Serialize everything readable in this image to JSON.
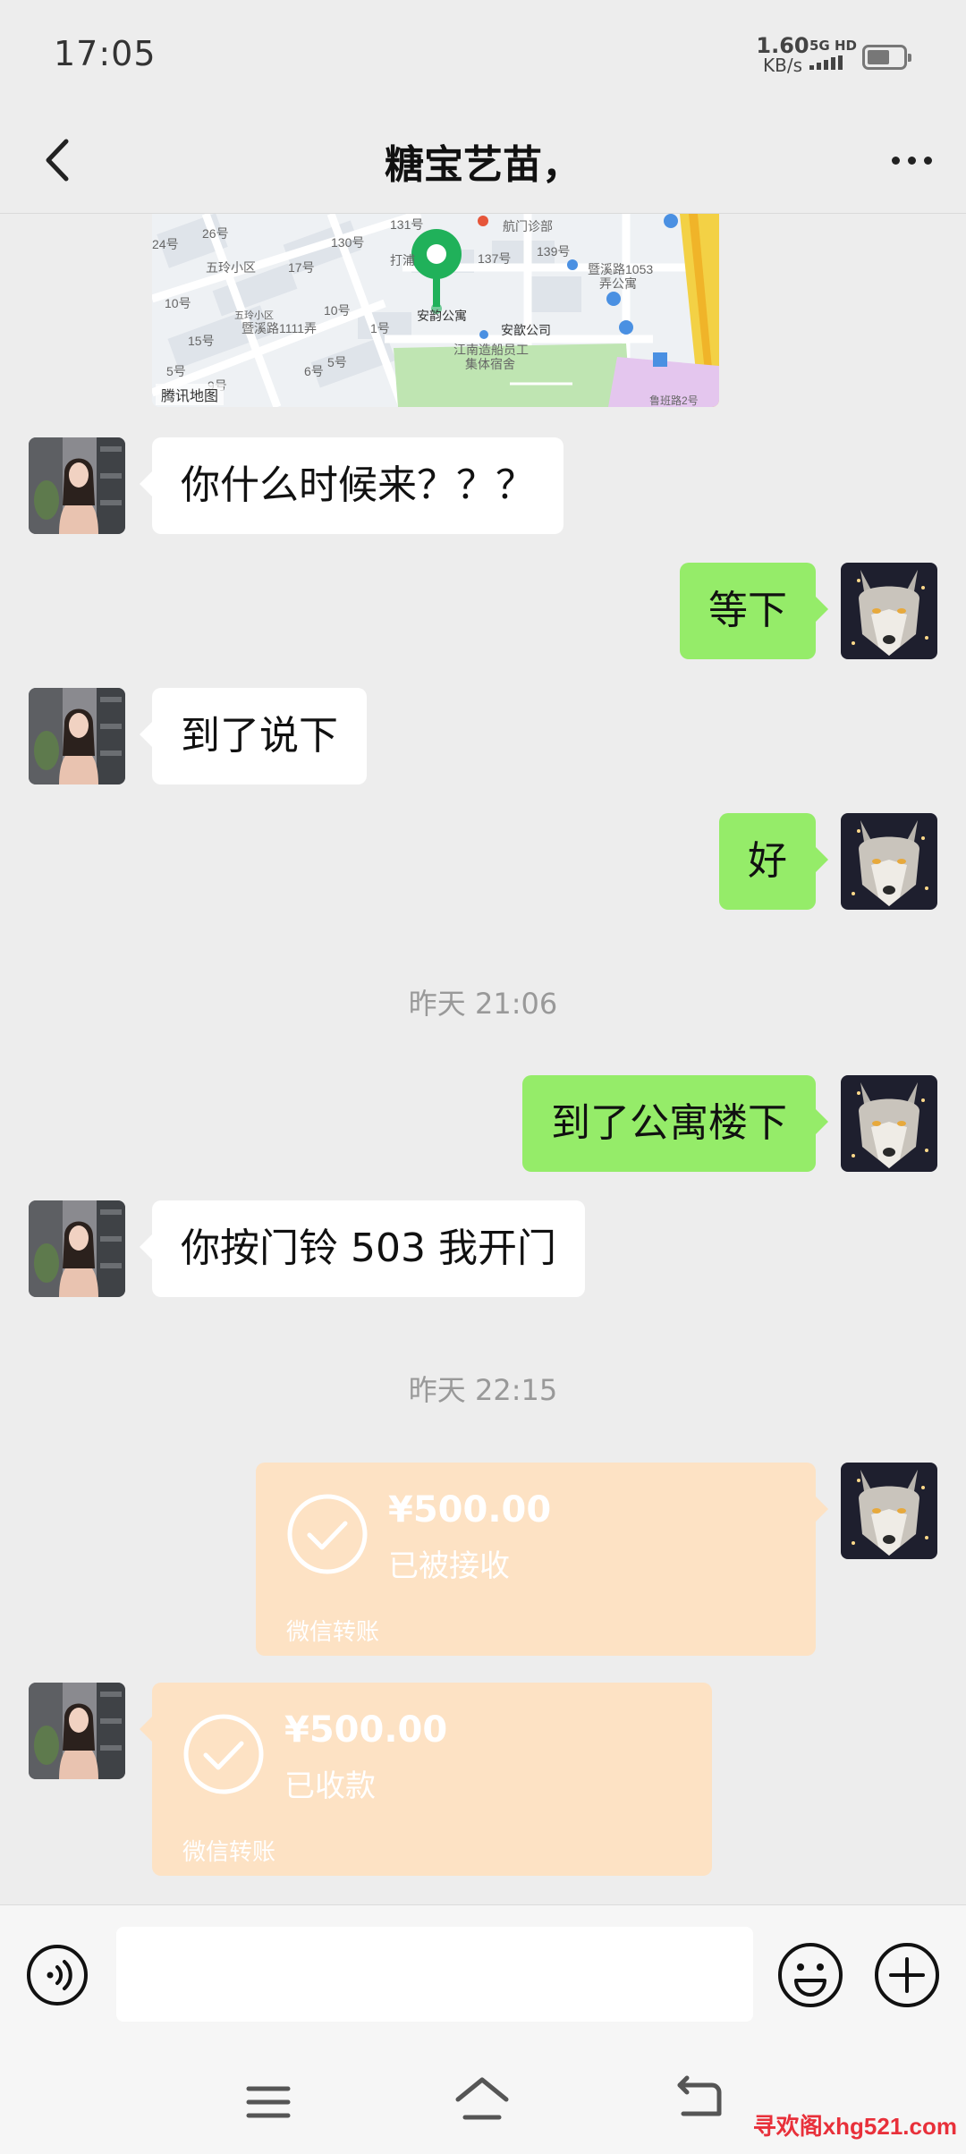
{
  "status_bar": {
    "time": "17:05",
    "net_speed": "1.60",
    "net_unit": "KB/s",
    "network": "5G HD",
    "battery_percent": 55
  },
  "header": {
    "title": "糖宝艺苗，",
    "back_icon": "chevron-left-icon",
    "more_icon": "more-dots-icon"
  },
  "map": {
    "provider": "腾讯地图",
    "labels": [
      "航门诊部",
      "打浦",
      "安韵公寓",
      "安歆公司",
      "江南造船员工",
      "集体宿舍",
      "暨溪路1053",
      "弄公寓",
      "五玲小区",
      "五玲小区",
      "暨溪路1111弄",
      "1号",
      "137号",
      "139号",
      "130号",
      "131号",
      "26号",
      "24号",
      "17号",
      "10号",
      "10号",
      "15号",
      "5号",
      "6号",
      "5号",
      "9号",
      "鲁班路2号"
    ]
  },
  "messages": [
    {
      "side": "in",
      "text": "你什么时候来？？？"
    },
    {
      "side": "out",
      "text": "等下"
    },
    {
      "side": "in",
      "text": "到了说下"
    },
    {
      "side": "out",
      "text": "好"
    },
    {
      "type": "time",
      "text": "昨天 21:06"
    },
    {
      "side": "out",
      "text": "到了公寓楼下"
    },
    {
      "side": "in",
      "text": "你按门铃 503 我开门"
    },
    {
      "type": "time",
      "text": "昨天 22:15"
    }
  ],
  "transfers": [
    {
      "side": "out",
      "amount": "¥500.00",
      "status": "已被接收",
      "label": "微信转账"
    },
    {
      "side": "in",
      "amount": "¥500.00",
      "status": "已收款",
      "label": "微信转账"
    }
  ],
  "input_bar": {
    "voice_icon": "voice-icon",
    "placeholder": "",
    "emoji_icon": "emoji-icon",
    "plus_icon": "plus-icon"
  },
  "nav_bar": {
    "menu_icon": "menu-icon",
    "home_icon": "home-icon",
    "back_icon": "back-icon"
  },
  "watermark": "寻欢阁xhg521.com",
  "colors": {
    "chat_bg": "#ededed",
    "bubble_out": "#95ec69",
    "bubble_in": "#ffffff",
    "transfer": "#fde2c4"
  }
}
